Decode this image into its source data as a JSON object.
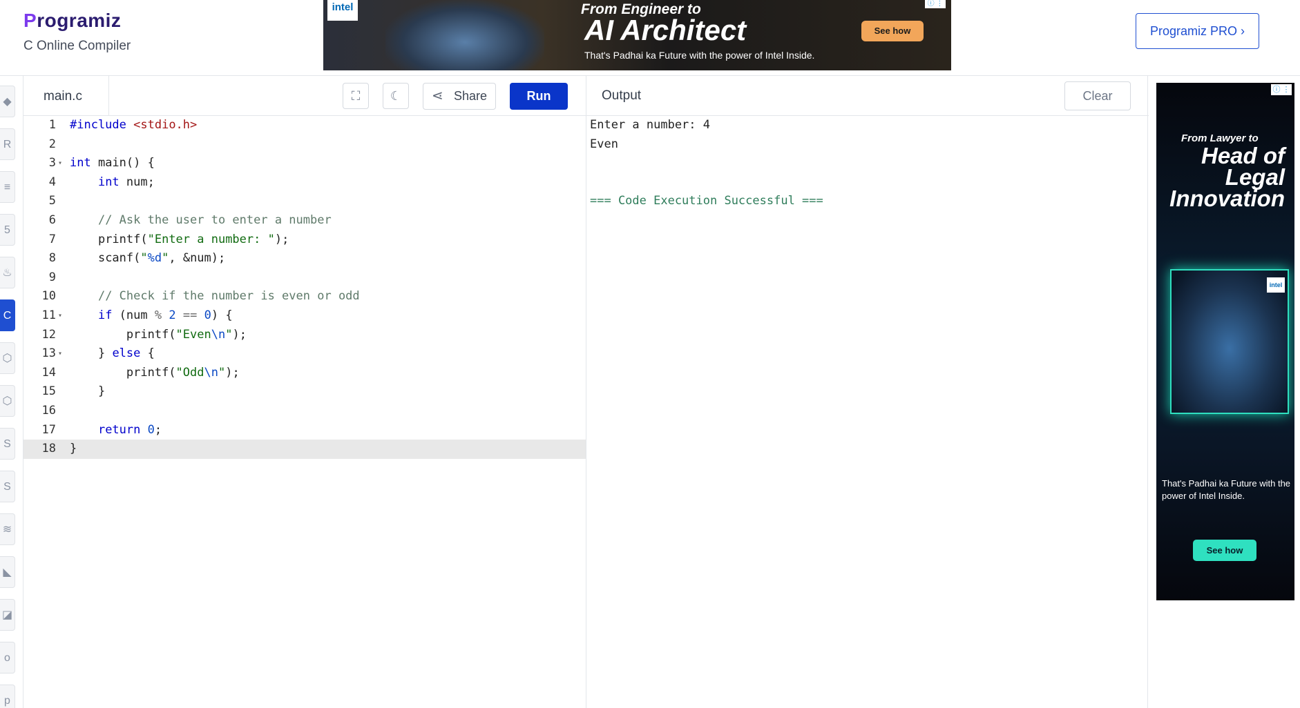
{
  "header": {
    "logo_letter": "P",
    "logo_rest": "rogramiz",
    "subtitle": "C Online Compiler",
    "pro_button": "Programiz PRO ›"
  },
  "ad_top": {
    "brand": "intel",
    "line1": "From Engineer to",
    "line2": "AI Architect",
    "line3": "That's Padhai ka Future with the power of Intel Inside.",
    "cta": "See how",
    "adchoice": "ⓘ ⋮"
  },
  "editor": {
    "tab": "main.c",
    "share_label": "Share",
    "run_label": "Run",
    "lines": [
      {
        "n": "1",
        "fold": ""
      },
      {
        "n": "2",
        "fold": ""
      },
      {
        "n": "3",
        "fold": "▾"
      },
      {
        "n": "4",
        "fold": ""
      },
      {
        "n": "5",
        "fold": ""
      },
      {
        "n": "6",
        "fold": ""
      },
      {
        "n": "7",
        "fold": ""
      },
      {
        "n": "8",
        "fold": ""
      },
      {
        "n": "9",
        "fold": ""
      },
      {
        "n": "10",
        "fold": ""
      },
      {
        "n": "11",
        "fold": "▾"
      },
      {
        "n": "12",
        "fold": ""
      },
      {
        "n": "13",
        "fold": "▾"
      },
      {
        "n": "14",
        "fold": ""
      },
      {
        "n": "15",
        "fold": ""
      },
      {
        "n": "16",
        "fold": ""
      },
      {
        "n": "17",
        "fold": ""
      },
      {
        "n": "18",
        "fold": ""
      }
    ],
    "code": {
      "l1_kw": "#include",
      "l1_str": "<stdio.h>",
      "l3_kw": "int",
      "l3_rest": " main() {",
      "l4_kw": "int",
      "l4_rest": " num;",
      "l6_comment": "// Ask the user to enter a number",
      "l7_fn": "printf(",
      "l7_str": "\"Enter a number: \"",
      "l7_end": ");",
      "l8_fn": "scanf(",
      "l8_str1": "\"",
      "l8_fmt": "%d",
      "l8_str2": "\"",
      "l8_end": ", &num);",
      "l10_comment": "// Check if the number is even or odd",
      "l11_kw": "if",
      "l11_a": " (num ",
      "l11_op": "%",
      "l11_b": " ",
      "l11_n1": "2",
      "l11_c": " ",
      "l11_op2": "==",
      "l11_d": " ",
      "l11_n2": "0",
      "l11_e": ") {",
      "l12_fn": "printf(",
      "l12_str1": "\"Even",
      "l12_esc": "\\n",
      "l12_str2": "\"",
      "l12_end": ");",
      "l13_a": "} ",
      "l13_kw": "else",
      "l13_b": " {",
      "l14_fn": "printf(",
      "l14_str1": "\"Odd",
      "l14_esc": "\\n",
      "l14_str2": "\"",
      "l14_end": ");",
      "l15": "}",
      "l17_kw": "return",
      "l17_sp": " ",
      "l17_num": "0",
      "l17_end": ";",
      "l18": "}"
    }
  },
  "output": {
    "title": "Output",
    "clear_label": "Clear",
    "lines": [
      "Enter a number: 4",
      "Even",
      "",
      ""
    ],
    "success": "=== Code Execution Successful ==="
  },
  "ad_side": {
    "adchoice": "ⓘ ⋮",
    "line1": "From Lawyer to",
    "line2": "Head of Legal Innovation",
    "brand": "intel",
    "line3": "That's Padhai ka Future with the power of Intel Inside.",
    "cta": "See how"
  },
  "sidebar": {
    "icons": [
      "python-icon",
      "r-icon",
      "sql-icon",
      "html-icon",
      "java-icon",
      "c-icon",
      "cpp-icon",
      "csharp-icon",
      "js-icon",
      "swift-icon",
      "go-icon",
      "kotlin-icon",
      "rust-icon",
      "php-icon"
    ]
  }
}
